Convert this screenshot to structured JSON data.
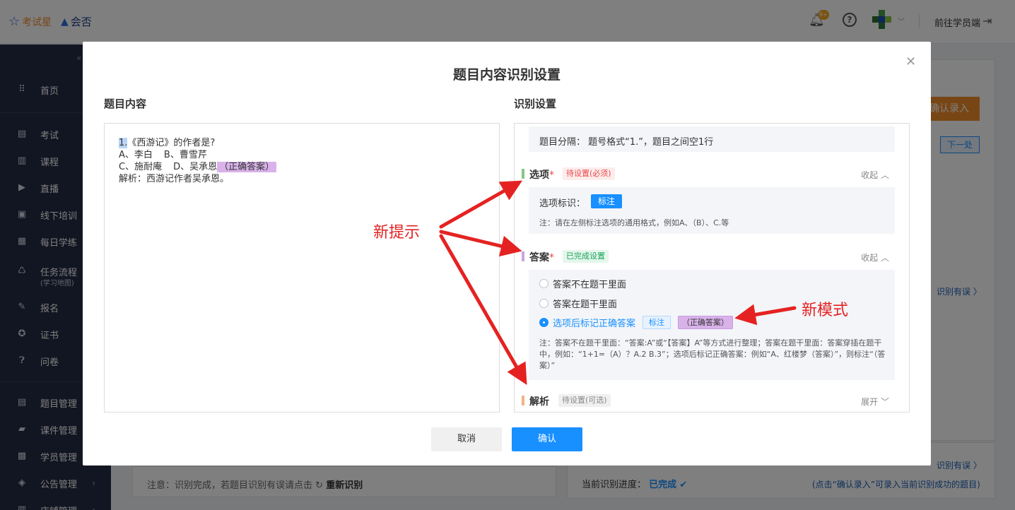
{
  "topbar": {
    "logo_primary": "考试星",
    "logo_secondary": "会否",
    "notification_badge": "9+",
    "goto_student": "前往学员端"
  },
  "sidebar": {
    "items": [
      {
        "label": "首页",
        "icon": "grid-icon"
      },
      {
        "label": "考试",
        "icon": "clipboard-icon"
      },
      {
        "label": "课程",
        "icon": "book-icon"
      },
      {
        "label": "直播",
        "icon": "play-icon"
      },
      {
        "label": "线下培训",
        "icon": "person-board-icon"
      },
      {
        "label": "每日学练",
        "icon": "calendar-check-icon"
      },
      {
        "label": "任务流程",
        "sub": "(学习地图)",
        "icon": "flow-icon"
      },
      {
        "label": "报名",
        "icon": "edit-form-icon"
      },
      {
        "label": "证书",
        "icon": "badge-icon"
      },
      {
        "label": "问卷",
        "icon": "question-doc-icon"
      },
      {
        "label": "题目管理",
        "icon": "list-doc-icon"
      },
      {
        "label": "课件管理",
        "icon": "folder-icon"
      },
      {
        "label": "学员管理",
        "icon": "user-card-icon"
      },
      {
        "label": "公告管理",
        "icon": "megaphone-icon"
      },
      {
        "label": "店铺管理",
        "icon": "shop-icon"
      }
    ]
  },
  "background": {
    "confirm_entry": "确认录入",
    "next_button": "下一处",
    "recognize_error_1": "识别有误 〉",
    "recognize_error_2": "识别有误 〉",
    "bottom_notice": "注意：识别完成，若题目识别有误请点击",
    "re_recognize": "重新识别",
    "progress_label": "当前识别进度：",
    "progress_value": "已完成",
    "progress_hint": "(点击“确认录入”可录入当前识别成功的题目)"
  },
  "modal": {
    "title": "题目内容识别设置",
    "left_heading": "题目内容",
    "right_heading": "识别设置",
    "editor": {
      "line1_num": "1.",
      "line1_rest": "《西游记》的作者是?",
      "line2_a": "A、李白",
      "line2_b": "B、曹雪芹",
      "line3_c": "C、施耐庵",
      "line3_d": "D、吴承恩",
      "line3_mark": "（正确答案）",
      "line4": "解析：西游记作者吴承恩。"
    },
    "separator": "题目分隔：  题号格式“1.”，题目之间空1行",
    "options_group": {
      "title": "选项",
      "required": "*",
      "status": "待设置(必须)",
      "toggle": "收起 ︿",
      "mark_label": "选项标识：",
      "mark_button": "标注",
      "note": "注：请在左侧标注选项的通用格式，例如A、（B）、C.等"
    },
    "answer_group": {
      "title": "答案",
      "required": "*",
      "status": "已完成设置",
      "toggle": "收起 ︿",
      "radio1": "答案不在题干里面",
      "radio2": "答案在题干里面",
      "radio3": "选项后标记正确答案",
      "radio3_tag": "标注",
      "radio3_mark": "（正确答案）",
      "note": "注：答案不在题干里面：“答案:A”或“【答案】A”等方式进行整理；答案在题干里面：答案穿插在题干中，例如：“1+1=（A）？A.2 B.3”；选项后标记正确答案：例如“A、红楼梦（答案）”，则标注“（答案）”"
    },
    "analysis_group": {
      "title": "解析",
      "status": "待设置(可选)",
      "toggle": "展开 ﹀"
    },
    "cancel": "取消",
    "confirm": "确认"
  },
  "annotations": {
    "new_hint": "新提示",
    "new_mode": "新模式"
  },
  "colors": {
    "primary": "#1890ff",
    "sidebar_bg": "#252a44",
    "annotation_red": "#e52222",
    "mark_purple": "#d9b2ea",
    "orange": "#f08c2a"
  }
}
